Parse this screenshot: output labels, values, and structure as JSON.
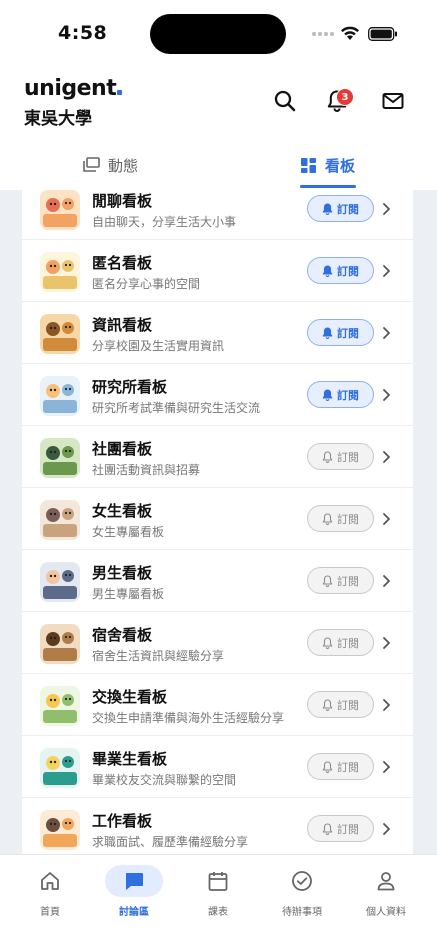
{
  "status_bar": {
    "time": "4:58"
  },
  "header": {
    "brand": "unigent",
    "school": "東吳大學",
    "notification_count": "3"
  },
  "tabs": [
    {
      "label": "動態",
      "active": false
    },
    {
      "label": "看板",
      "active": true
    }
  ],
  "boards": [
    {
      "title": "閒聊看板",
      "desc": "自由聊天，分享生活大小事",
      "subscribed": true,
      "subscribe_label": "訂閱"
    },
    {
      "title": "匿名看板",
      "desc": "匿名分享心事的空間",
      "subscribed": true,
      "subscribe_label": "訂閱"
    },
    {
      "title": "資訊看板",
      "desc": "分享校園及生活實用資訊",
      "subscribed": true,
      "subscribe_label": "訂閱"
    },
    {
      "title": "研究所看板",
      "desc": "研究所考試準備與研究生活交流",
      "subscribed": true,
      "subscribe_label": "訂閱"
    },
    {
      "title": "社團看板",
      "desc": "社團活動資訊與招募",
      "subscribed": false,
      "subscribe_label": "訂閱"
    },
    {
      "title": "女生看板",
      "desc": "女生專屬看板",
      "subscribed": false,
      "subscribe_label": "訂閱"
    },
    {
      "title": "男生看板",
      "desc": "男生專屬看板",
      "subscribed": false,
      "subscribe_label": "訂閱"
    },
    {
      "title": "宿舍看板",
      "desc": "宿舍生活資訊與經驗分享",
      "subscribed": false,
      "subscribe_label": "訂閱"
    },
    {
      "title": "交換生看板",
      "desc": "交換生申請準備與海外生活經驗分享",
      "subscribed": false,
      "subscribe_label": "訂閱"
    },
    {
      "title": "畢業生看板",
      "desc": "畢業校友交流與聯繫的空間",
      "subscribed": false,
      "subscribe_label": "訂閱"
    },
    {
      "title": "工作看板",
      "desc": "求職面試、履歷準備經驗分享",
      "subscribed": false,
      "subscribe_label": "訂閱"
    }
  ],
  "bottom_nav": [
    {
      "label": "首頁",
      "icon": "home-icon",
      "active": false
    },
    {
      "label": "討論區",
      "icon": "chat-icon",
      "active": true
    },
    {
      "label": "課表",
      "icon": "calendar-icon",
      "active": false
    },
    {
      "label": "待辦事項",
      "icon": "check-circle-icon",
      "active": false
    },
    {
      "label": "個人資料",
      "icon": "person-icon",
      "active": false
    }
  ],
  "colors": {
    "accent": "#2f6fe0",
    "badge": "#e53935",
    "subscribed_bg": "#e7efff",
    "content_bg": "#eceff3"
  }
}
